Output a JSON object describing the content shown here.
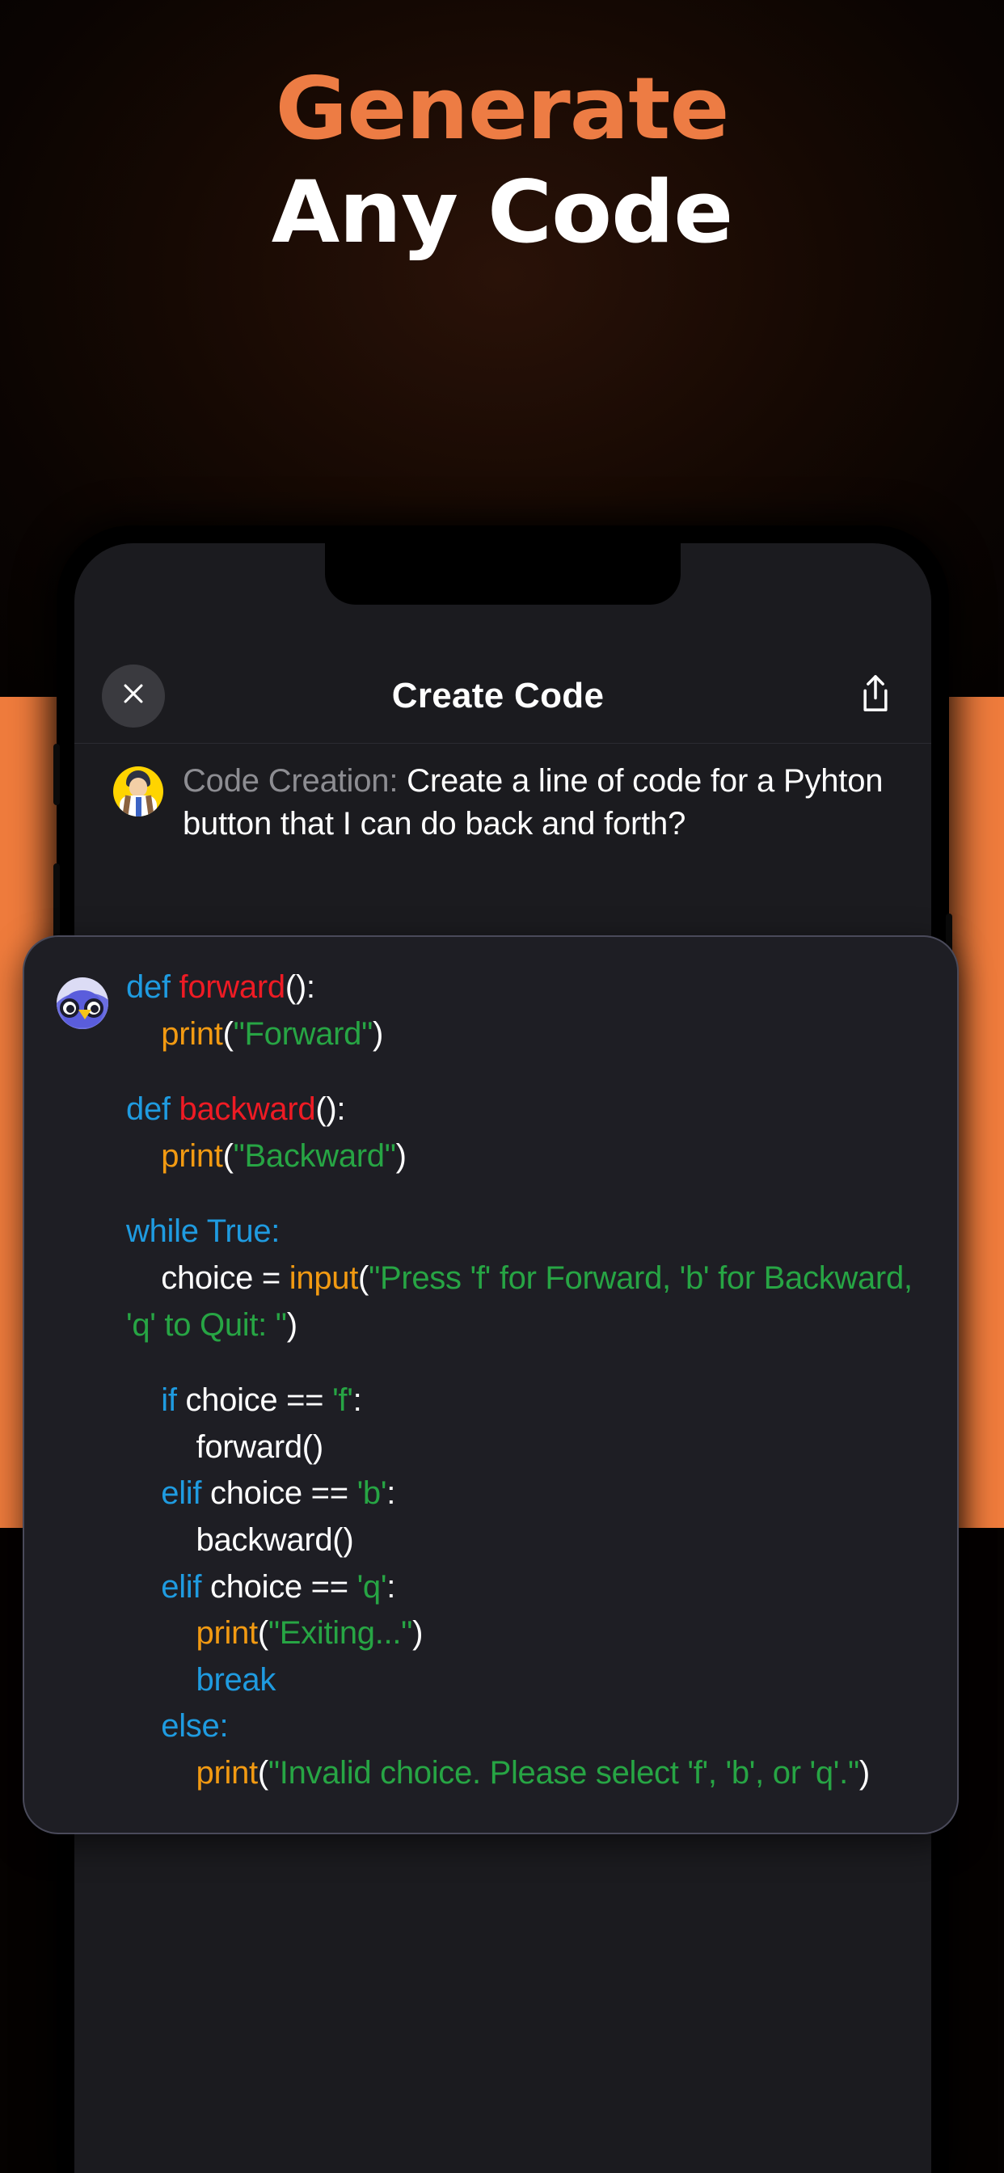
{
  "promo": {
    "line1": "Generate",
    "line2": "Any Code",
    "accent_color": "#ED7C44",
    "panel_color": "#EE7B3C",
    "background_color": "#060201"
  },
  "app": {
    "header": {
      "title": "Create Code",
      "close_icon": "close-x-icon",
      "share_icon": "share-upload-icon"
    },
    "user_message": {
      "avatar_icon": "user-avatar-icon",
      "prefix": "Code Creation:",
      "text": "Create a line of code for a Pyhton button that I can do back and forth?"
    },
    "assistant_message": {
      "avatar_icon": "owl-avatar-icon",
      "language": "python",
      "syntax_colors": {
        "keyword": "#1F9BE0",
        "function_name": "#EE1B24",
        "builtin": "#F29A12",
        "string": "#27A544",
        "plain": "#FFFFFF",
        "card_background": "#1E1E24"
      },
      "code_lines": [
        [
          {
            "t": "def ",
            "c": "kw"
          },
          {
            "t": "forward",
            "c": "fn"
          },
          {
            "t": "():",
            "c": "pn"
          }
        ],
        [
          {
            "t": "    ",
            "c": "pn"
          },
          {
            "t": "print",
            "c": "bi"
          },
          {
            "t": "(",
            "c": "pn"
          },
          {
            "t": "\"Forward\"",
            "c": "str"
          },
          {
            "t": ")",
            "c": "pn"
          }
        ],
        [],
        [
          {
            "t": "def ",
            "c": "kw"
          },
          {
            "t": "backward",
            "c": "fn"
          },
          {
            "t": "():",
            "c": "pn"
          }
        ],
        [
          {
            "t": "    ",
            "c": "pn"
          },
          {
            "t": "print",
            "c": "bi"
          },
          {
            "t": "(",
            "c": "pn"
          },
          {
            "t": "\"Backward\"",
            "c": "str"
          },
          {
            "t": ")",
            "c": "pn"
          }
        ],
        [],
        [
          {
            "t": "while True:",
            "c": "kw"
          }
        ],
        [
          {
            "t": "    choice = ",
            "c": "pn"
          },
          {
            "t": "input",
            "c": "bi"
          },
          {
            "t": "(",
            "c": "pn"
          },
          {
            "t": "\"Press 'f' for Forward, 'b' for Backward, 'q' to Quit: \"",
            "c": "str"
          },
          {
            "t": ")",
            "c": "pn"
          }
        ],
        [],
        [
          {
            "t": "    ",
            "c": "pn"
          },
          {
            "t": "if",
            "c": "kw"
          },
          {
            "t": " choice == ",
            "c": "pn"
          },
          {
            "t": "'f'",
            "c": "str"
          },
          {
            "t": ":",
            "c": "pn"
          }
        ],
        [
          {
            "t": "        forward()",
            "c": "pn"
          }
        ],
        [
          {
            "t": "    ",
            "c": "pn"
          },
          {
            "t": "elif",
            "c": "kw"
          },
          {
            "t": " choice == ",
            "c": "pn"
          },
          {
            "t": "'b'",
            "c": "str"
          },
          {
            "t": ":",
            "c": "pn"
          }
        ],
        [
          {
            "t": "        backward()",
            "c": "pn"
          }
        ],
        [
          {
            "t": "    ",
            "c": "pn"
          },
          {
            "t": "elif",
            "c": "kw"
          },
          {
            "t": " choice == ",
            "c": "pn"
          },
          {
            "t": "'q'",
            "c": "str"
          },
          {
            "t": ":",
            "c": "pn"
          }
        ],
        [
          {
            "t": "        ",
            "c": "pn"
          },
          {
            "t": "print",
            "c": "bi"
          },
          {
            "t": "(",
            "c": "pn"
          },
          {
            "t": "\"Exiting...\"",
            "c": "str"
          },
          {
            "t": ")",
            "c": "pn"
          }
        ],
        [
          {
            "t": "        ",
            "c": "pn"
          },
          {
            "t": "break",
            "c": "kw"
          }
        ],
        [
          {
            "t": "    ",
            "c": "pn"
          },
          {
            "t": "else",
            "c": "kw"
          },
          {
            "t": ":",
            "c": "kw"
          }
        ],
        [
          {
            "t": "        ",
            "c": "pn"
          },
          {
            "t": "print",
            "c": "bi"
          },
          {
            "t": "(",
            "c": "pn"
          },
          {
            "t": "\"Invalid choice. Please select 'f', 'b', or 'q'.\"",
            "c": "str"
          },
          {
            "t": ")",
            "c": "pn"
          }
        ]
      ]
    }
  }
}
